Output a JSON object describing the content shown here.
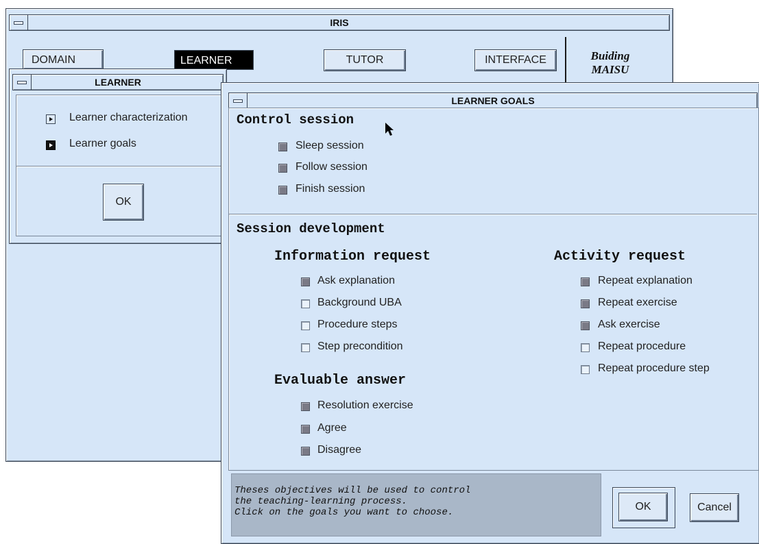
{
  "main_window": {
    "title": "IRIS",
    "tabs": [
      "DOMAIN",
      "LEARNER",
      "TUTOR",
      "INTERFACE"
    ],
    "selected_tab": "LEARNER",
    "brand": [
      "Buiding",
      "MAISU"
    ]
  },
  "learner_window": {
    "title": "LEARNER",
    "items": [
      "Learner characterization",
      "Learner goals"
    ],
    "ok_label": "OK"
  },
  "goals_window": {
    "title": "LEARNER GOALS",
    "control_session": {
      "heading": "Control session",
      "items": [
        {
          "label": "Sleep session",
          "checked": true
        },
        {
          "label": "Follow session",
          "checked": true
        },
        {
          "label": "Finish session",
          "checked": true
        }
      ]
    },
    "session_development": {
      "heading": "Session development",
      "information_request": {
        "heading": "Information request",
        "items": [
          {
            "label": "Ask explanation",
            "checked": true
          },
          {
            "label": "Background UBA",
            "checked": false
          },
          {
            "label": "Procedure steps",
            "checked": false
          },
          {
            "label": "Step precondition",
            "checked": false
          }
        ]
      },
      "evaluable_answer": {
        "heading": "Evaluable answer",
        "items": [
          {
            "label": "Resolution exercise",
            "checked": true
          },
          {
            "label": "Agree",
            "checked": true
          },
          {
            "label": "Disagree",
            "checked": true
          }
        ]
      },
      "activity_request": {
        "heading": "Activity request",
        "items": [
          {
            "label": "Repeat explanation",
            "checked": true
          },
          {
            "label": "Repeat exercise",
            "checked": true
          },
          {
            "label": "Ask exercise",
            "checked": true
          },
          {
            "label": "Repeat procedure",
            "checked": false
          },
          {
            "label": "Repeat procedure step",
            "checked": false
          }
        ]
      }
    },
    "help_text": [
      "Theses objectives will be used to control",
      "the teaching-learning process.",
      "Click on the goals you want to choose."
    ],
    "ok_label": "OK",
    "cancel_label": "Cancel"
  }
}
